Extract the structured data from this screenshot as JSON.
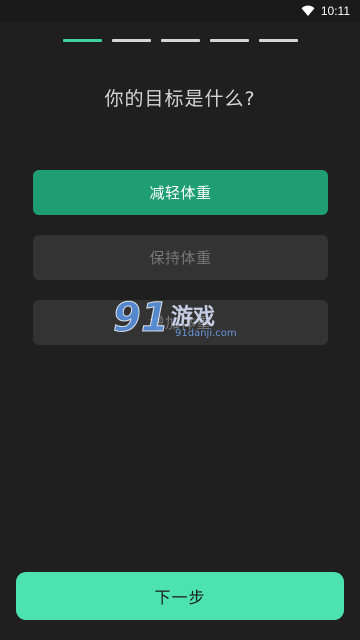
{
  "status_bar": {
    "time": "10:11",
    "icon": "wifi-icon"
  },
  "progress": {
    "total_steps": 5,
    "current_step": 1
  },
  "question": {
    "title": "你的目标是什么?"
  },
  "options": [
    {
      "label": "减轻体重",
      "selected": true
    },
    {
      "label": "保持体重",
      "selected": false
    },
    {
      "label": "增加体重",
      "selected": false
    }
  ],
  "watermark": {
    "logo": "91",
    "text": "游戏",
    "url": "91danji.com"
  },
  "footer": {
    "next_label": "下一步"
  },
  "colors": {
    "accent": "#4de3b0",
    "selected_option": "#1e9e72",
    "background": "#1f1f1f"
  }
}
